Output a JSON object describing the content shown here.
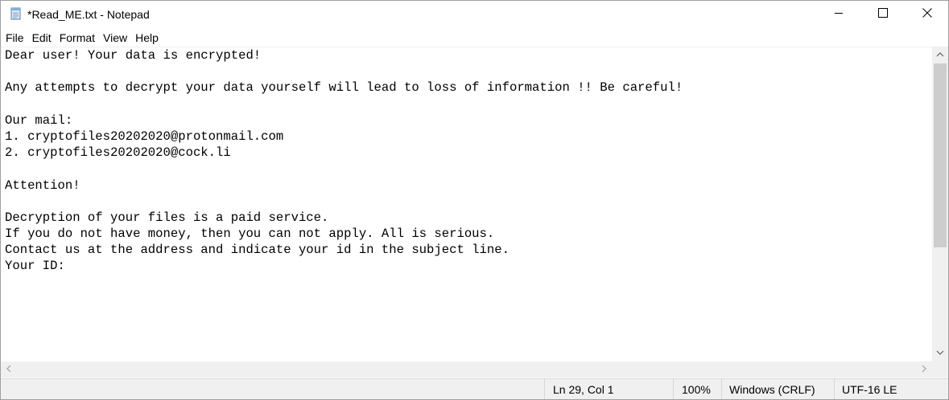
{
  "window": {
    "title": "*Read_ME.txt - Notepad",
    "icon": "notepad-icon",
    "controls": {
      "minimize": "minimize-icon",
      "maximize": "maximize-icon",
      "close": "close-icon"
    }
  },
  "menu": {
    "items": [
      "File",
      "Edit",
      "Format",
      "View",
      "Help"
    ]
  },
  "document": {
    "lines": [
      "Dear user! Your data is encrypted!",
      "",
      "Any attempts to decrypt your data yourself will lead to loss of information !! Be careful!",
      "",
      "Our mail:",
      "1. cryptofiles20202020@protonmail.com",
      "2. cryptofiles20202020@cock.li",
      "",
      "Attention!",
      "",
      "Decryption of your files is a paid service.",
      "If you do not have money, then you can not apply. All is serious.",
      "Contact us at the address and indicate your id in the subject line.",
      "Your ID:"
    ]
  },
  "statusbar": {
    "position": "Ln 29, Col 1",
    "zoom": "100%",
    "line_ending": "Windows (CRLF)",
    "encoding": "UTF-16 LE"
  },
  "colors": {
    "chrome_bg": "#f0f0f0",
    "scroll_thumb": "#cdcdcd",
    "text": "#000000"
  }
}
